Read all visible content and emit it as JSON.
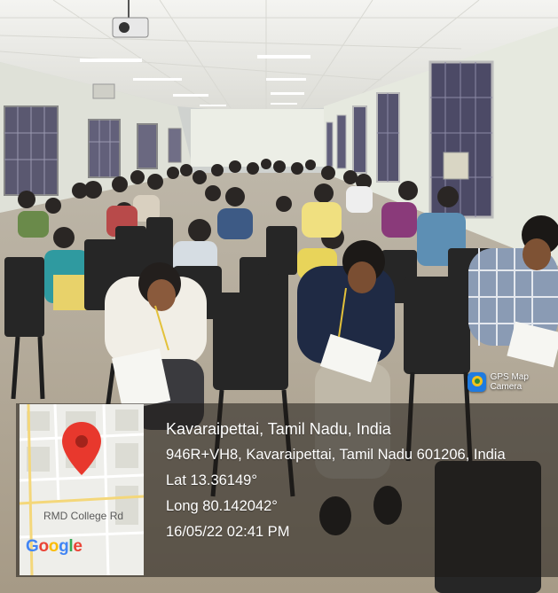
{
  "stamp": {
    "app_name": "GPS Map Camera",
    "app_icon": "gps-map-camera-icon",
    "place": "Kavaraipettai, Tamil Nadu, India",
    "address": "946R+VH8, Kavaraipettai, Tamil Nadu 601206, India",
    "latitude": "Lat 13.36149°",
    "longitude": "Long 80.142042°",
    "datetime": "16/05/22 02:41 PM"
  },
  "map": {
    "road_label": "RMD College Rd",
    "logo_text": "Google",
    "pin_icon": "map-pin-icon",
    "pin_color": "#e8382d"
  },
  "colors": {
    "ceiling": "#f2f2ef",
    "wall": "#e9ece4",
    "floor": "#c9bfae",
    "chair": "#2b2b2b",
    "overlay": "#1e1a16"
  }
}
